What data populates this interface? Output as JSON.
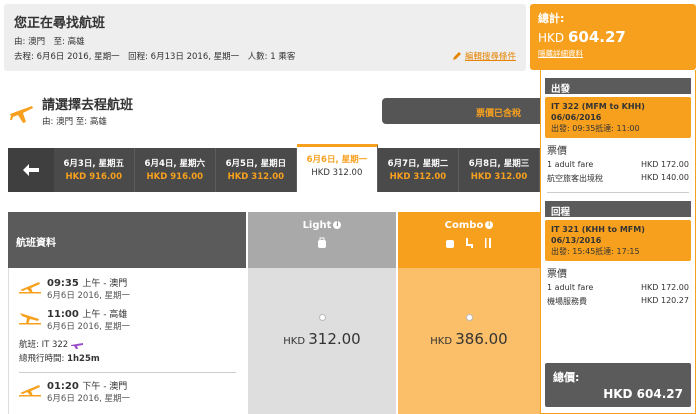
{
  "search": {
    "title": "您正在尋找航班",
    "route": "由: 澳門　至: 高雄",
    "dates": "去程: 6月6日 2016, 星期一　回程: 6月13日 2016, 星期一　人數: 1 乘客",
    "edit_label": "編輯搜尋條件"
  },
  "select": {
    "title": "請選擇去程航班",
    "route": "由: 澳門 至: 高雄",
    "status": "票價已含稅"
  },
  "dates": [
    {
      "date": "6月3日, 星期五",
      "price": "HKD 916.00"
    },
    {
      "date": "6月4日, 星期六",
      "price": "HKD 916.00"
    },
    {
      "date": "6月5日, 星期日",
      "price": "HKD 312.00"
    },
    {
      "date": "6月6日, 星期一",
      "price": "HKD 312.00"
    },
    {
      "date": "6月7日, 星期二",
      "price": "HKD 312.00"
    },
    {
      "date": "6月8日, 星期三",
      "price": "HKD 312.00"
    }
  ],
  "table": {
    "info_header": "航班資料",
    "light_header": "Light",
    "combo_header": "Combo",
    "light_price_currency": "HKD",
    "light_price": "312.00",
    "combo_price_currency": "HKD",
    "combo_price": "386.00"
  },
  "flight": {
    "dep_time": "09:35",
    "dep_suffix": "上午 - 澳門",
    "dep_date": "6月6日 2016, 星期一",
    "arr_time": "11:00",
    "arr_suffix": "上午 - 高雄",
    "arr_date": "6月6日 2016, 星期一",
    "flight_no": "航班: IT 322",
    "duration_label": "總飛行時間:",
    "duration": "1h25m",
    "next_time": "01:20",
    "next_suffix": "下午 - 澳門",
    "next_date": "6月6日 2016, 星期一"
  },
  "summary": {
    "total_label": "總計:",
    "total_currency": "HKD",
    "total_amount": "604.27",
    "detail_link": "隱藏詳細資料",
    "outbound": {
      "heading": "出發",
      "flight": "IT 322 (MFM to KHH)",
      "date": "06/06/2016",
      "times": "出發: 09:35抵達: 11:00",
      "fare_label": "票價",
      "rows": [
        {
          "name": "1 adult fare",
          "value": "HKD 172.00"
        },
        {
          "name": "航空旅客出境稅",
          "value": "HKD 140.00"
        }
      ]
    },
    "inbound": {
      "heading": "回程",
      "flight": "IT 321 (KHH to MFM)",
      "date": "06/13/2016",
      "times": "出發: 15:45抵達: 17:15",
      "fare_label": "票價",
      "rows": [
        {
          "name": "1 adult fare",
          "value": "HKD 172.00"
        },
        {
          "name": "機場服務費",
          "value": "HKD 120.27"
        }
      ]
    },
    "grand_label": "總價:",
    "grand_amount": "HKD 604.27"
  },
  "colors": {
    "accent": "#f7a01e",
    "dark": "#5b5b5b"
  }
}
